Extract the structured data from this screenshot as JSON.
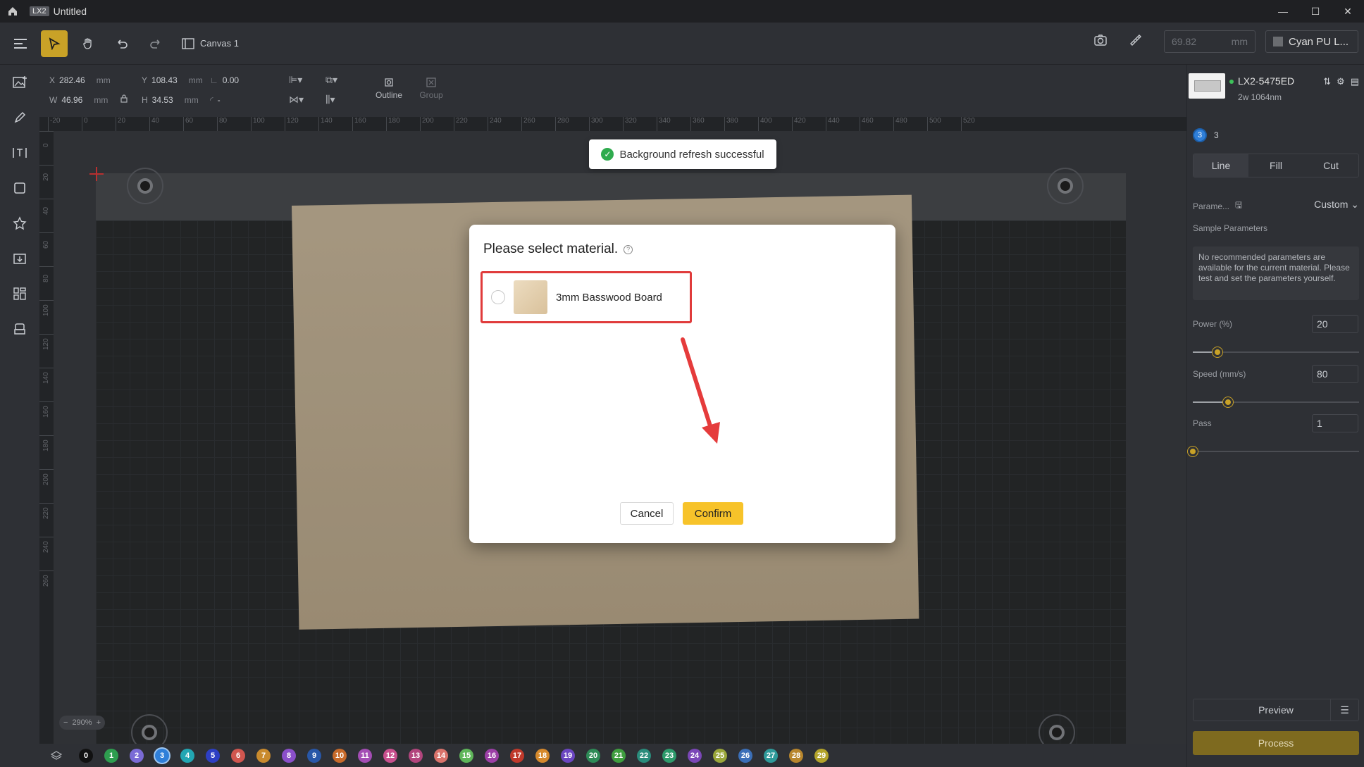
{
  "titlebar": {
    "app_badge": "LX2",
    "title": "Untitled"
  },
  "toolbar": {
    "canvas_tab": "Canvas 1",
    "dimension_value": "69.82",
    "dimension_unit": "mm",
    "material": "Cyan PU L..."
  },
  "props": {
    "x_label": "X",
    "x_value": "282.46",
    "x_unit": "mm",
    "y_label": "Y",
    "y_value": "108.43",
    "y_unit": "mm",
    "angle_value": "0.00",
    "w_label": "W",
    "w_value": "46.96",
    "w_unit": "mm",
    "h_label": "H",
    "h_value": "34.53",
    "h_unit": "mm",
    "corner_value": "-",
    "outline_label": "Outline",
    "group_label": "Group"
  },
  "ruler": {
    "h_ticks": [
      "-20",
      "0",
      "20",
      "40",
      "60",
      "80",
      "100",
      "120",
      "140",
      "160",
      "180",
      "200",
      "220",
      "240",
      "260",
      "280",
      "300",
      "320",
      "340",
      "360",
      "380",
      "400",
      "420",
      "440",
      "460",
      "480",
      "500",
      "520"
    ],
    "v_ticks": [
      "0",
      "20",
      "40",
      "60",
      "80",
      "100",
      "120",
      "140",
      "160",
      "180",
      "200",
      "220",
      "240",
      "260"
    ]
  },
  "zoom": {
    "value": "290%",
    "minus": "−",
    "plus": "+"
  },
  "toast": {
    "message": "Background refresh successful"
  },
  "modal": {
    "title": "Please select material.",
    "help": "?",
    "option_name": "3mm Basswood Board",
    "cancel": "Cancel",
    "confirm": "Confirm"
  },
  "right_panel": {
    "device_name": "LX2-5475ED",
    "device_sub": "2w 1064nm",
    "layer_number": "3",
    "layer_label": "3",
    "tabs": [
      "Line",
      "Fill",
      "Cut"
    ],
    "selected_tab": "Line",
    "param_label": "Parame...",
    "param_mode": "Custom",
    "sample_label": "Sample Parameters",
    "notice": "No recommended parameters are available for the current material. Please test and set the parameters yourself.",
    "power_label": "Power  (%)",
    "power_value": "20",
    "power_level": 0.15,
    "speed_label": "Speed  (mm/s)",
    "speed_value": "80",
    "speed_level": 0.21,
    "pass_label": "Pass",
    "pass_value": "1",
    "pass_level": 0.0,
    "preview": "Preview",
    "process": "Process"
  },
  "colorbar": {
    "layers": [
      {
        "label": "0",
        "color": "#111111"
      },
      {
        "label": "1",
        "color": "#2e9e4f"
      },
      {
        "label": "2",
        "color": "#7a6bd6"
      },
      {
        "label": "3",
        "color": "#2f7fd9"
      },
      {
        "label": "4",
        "color": "#22a6b3"
      },
      {
        "label": "5",
        "color": "#2d3fc4"
      },
      {
        "label": "6",
        "color": "#d0564f"
      },
      {
        "label": "7",
        "color": "#c98a2d"
      },
      {
        "label": "8",
        "color": "#8a4fc9"
      },
      {
        "label": "9",
        "color": "#2857a8"
      },
      {
        "label": "10",
        "color": "#c76a2a"
      },
      {
        "label": "11",
        "color": "#a44db5"
      },
      {
        "label": "12",
        "color": "#c8508e"
      },
      {
        "label": "13",
        "color": "#b2457d"
      },
      {
        "label": "14",
        "color": "#d9736b"
      },
      {
        "label": "15",
        "color": "#5fb65a"
      },
      {
        "label": "16",
        "color": "#9c3fa6"
      },
      {
        "label": "17",
        "color": "#c0392b"
      },
      {
        "label": "18",
        "color": "#d6892c"
      },
      {
        "label": "19",
        "color": "#6b46c1"
      },
      {
        "label": "20",
        "color": "#2e8b57"
      },
      {
        "label": "21",
        "color": "#3f9e3f"
      },
      {
        "label": "22",
        "color": "#2a8c7c"
      },
      {
        "label": "23",
        "color": "#2d9a6b"
      },
      {
        "label": "24",
        "color": "#7b47b8"
      },
      {
        "label": "25",
        "color": "#9aa63a"
      },
      {
        "label": "26",
        "color": "#3b6fb8"
      },
      {
        "label": "27",
        "color": "#2f9a9a"
      },
      {
        "label": "28",
        "color": "#b8862d"
      },
      {
        "label": "29",
        "color": "#b3a32a"
      }
    ]
  },
  "colors": {
    "accent": "#c9a227",
    "confirm": "#f7c32a",
    "highlight": "#e03b3b",
    "success": "#2fab4e"
  }
}
